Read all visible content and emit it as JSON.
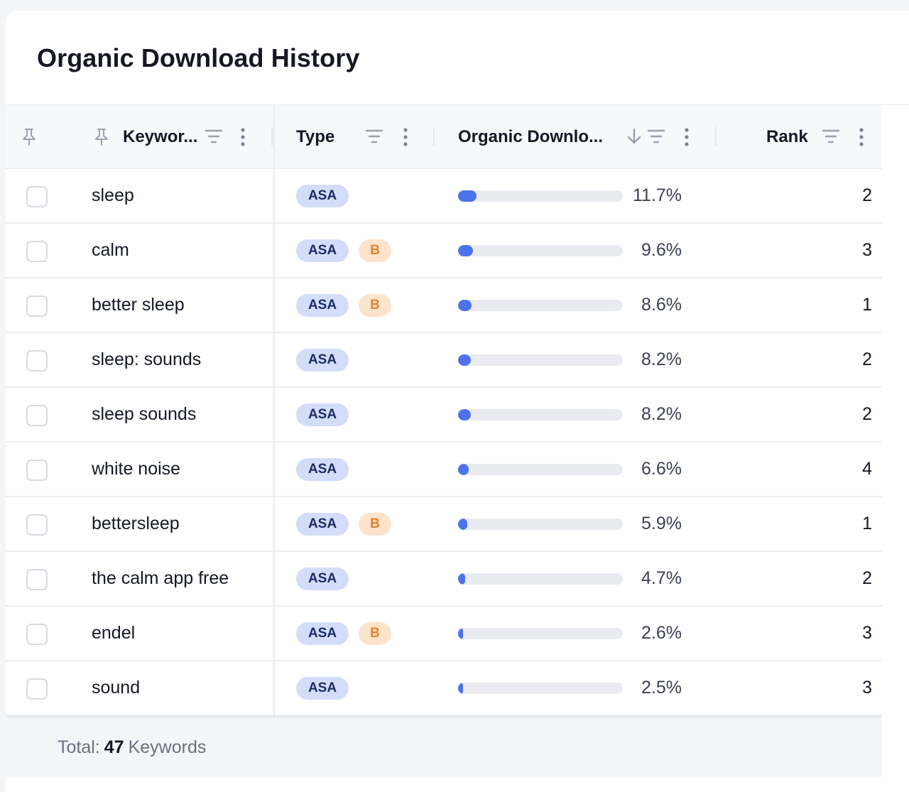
{
  "title": "Organic Download History",
  "header": {
    "keyword": "Keywor...",
    "type": "Type",
    "organic": "Organic Downlo...",
    "rank": "Rank"
  },
  "rows": [
    {
      "keyword": "sleep",
      "type": "ASA",
      "b": "",
      "share": 11.7,
      "share_label": "11.7%",
      "rank": "2"
    },
    {
      "keyword": "calm",
      "type": "ASA",
      "b": "B",
      "share": 9.6,
      "share_label": "9.6%",
      "rank": "3"
    },
    {
      "keyword": "better sleep",
      "type": "ASA",
      "b": "B",
      "share": 8.6,
      "share_label": "8.6%",
      "rank": "1"
    },
    {
      "keyword": "sleep: sounds",
      "type": "ASA",
      "b": "",
      "share": 8.2,
      "share_label": "8.2%",
      "rank": "2"
    },
    {
      "keyword": "sleep sounds",
      "type": "ASA",
      "b": "",
      "share": 8.2,
      "share_label": "8.2%",
      "rank": "2"
    },
    {
      "keyword": "white noise",
      "type": "ASA",
      "b": "",
      "share": 6.6,
      "share_label": "6.6%",
      "rank": "4"
    },
    {
      "keyword": "bettersleep",
      "type": "ASA",
      "b": "B",
      "share": 5.9,
      "share_label": "5.9%",
      "rank": "1"
    },
    {
      "keyword": "the calm app free",
      "type": "ASA",
      "b": "",
      "share": 4.7,
      "share_label": "4.7%",
      "rank": "2"
    },
    {
      "keyword": "endel",
      "type": "ASA",
      "b": "B",
      "share": 2.6,
      "share_label": "2.6%",
      "rank": "3"
    },
    {
      "keyword": "sound",
      "type": "ASA",
      "b": "",
      "share": 2.5,
      "share_label": "2.5%",
      "rank": "3"
    }
  ],
  "footer": {
    "prefix": "Total:",
    "count": "47",
    "suffix": "Keywords"
  },
  "colors": {
    "bar": "#4c73ea",
    "asa_pill": "#d3ddfa",
    "b_pill": "#fce3cc"
  },
  "icons": [
    "pin-icon",
    "filter-icon",
    "more-vertical-icon",
    "sort-descending-icon"
  ]
}
